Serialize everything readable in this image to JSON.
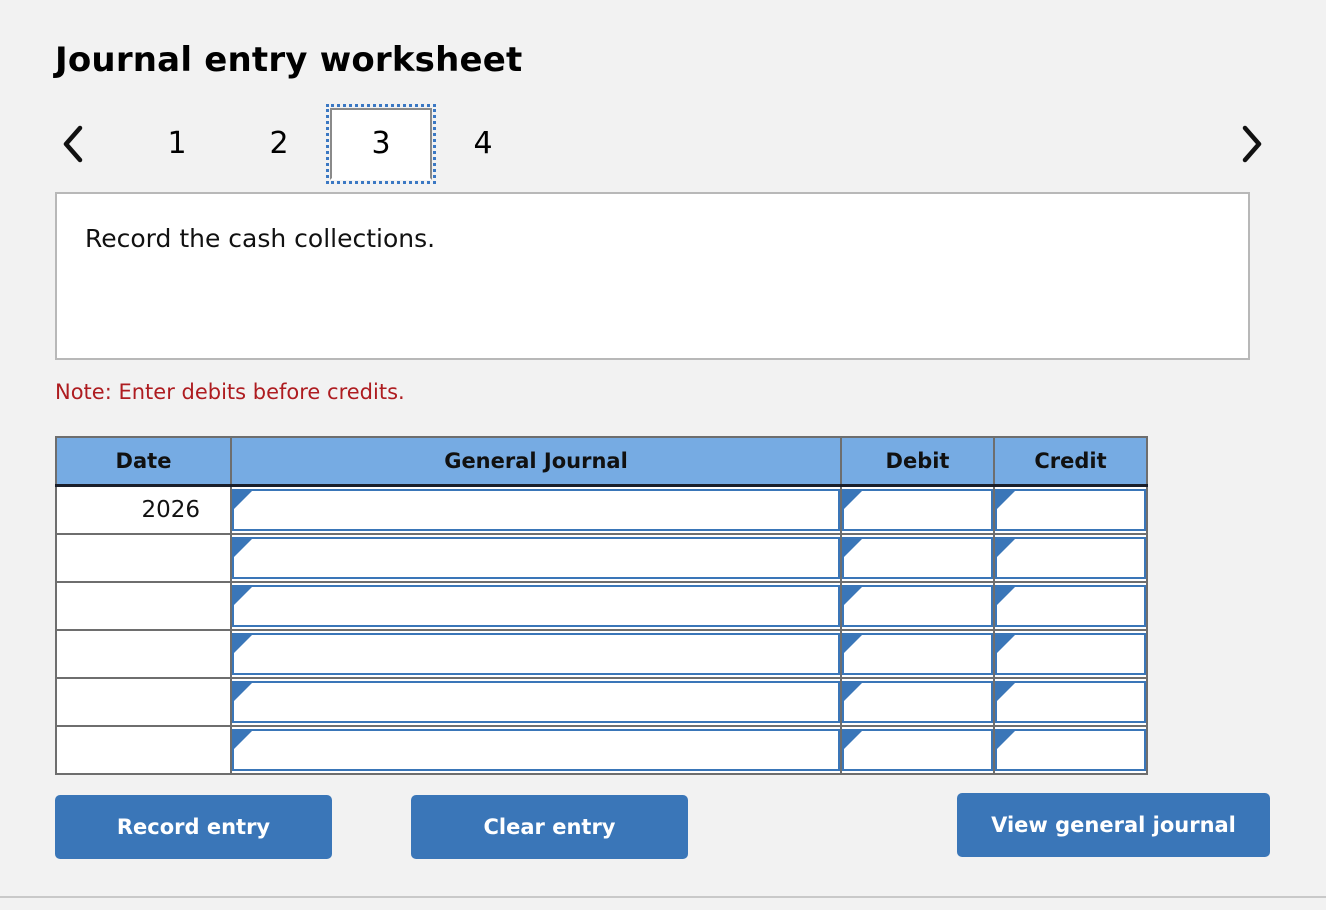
{
  "page": {
    "title": "Journal entry worksheet",
    "background_color": "#f2f2f2"
  },
  "pager": {
    "prev_label": "‹",
    "next_label": "›",
    "prev_icon": "chevron-left-icon",
    "next_icon": "chevron-right-icon",
    "active_index": 3,
    "tabs": [
      {
        "label": "1",
        "active": false
      },
      {
        "label": "2",
        "active": false
      },
      {
        "label": "3",
        "active": true
      },
      {
        "label": "4",
        "active": false
      }
    ]
  },
  "instruction": {
    "text": "Record the cash collections."
  },
  "note": {
    "text": "Note: Enter debits before credits.",
    "color": "#ae1c20"
  },
  "table": {
    "header_color": "#76abe3",
    "input_border_color": "#3a76b8",
    "columns": [
      "Date",
      "General Journal",
      "Debit",
      "Credit"
    ],
    "rows": [
      {
        "date": "2026",
        "journal": "",
        "debit": "",
        "credit": ""
      },
      {
        "date": "",
        "journal": "",
        "debit": "",
        "credit": ""
      },
      {
        "date": "",
        "journal": "",
        "debit": "",
        "credit": ""
      },
      {
        "date": "",
        "journal": "",
        "debit": "",
        "credit": ""
      },
      {
        "date": "",
        "journal": "",
        "debit": "",
        "credit": ""
      },
      {
        "date": "",
        "journal": "",
        "debit": "",
        "credit": ""
      }
    ]
  },
  "actions": {
    "record_label": "Record entry",
    "clear_label": "Clear entry",
    "view_label": "View general journal",
    "button_color": "#3a76b8"
  }
}
